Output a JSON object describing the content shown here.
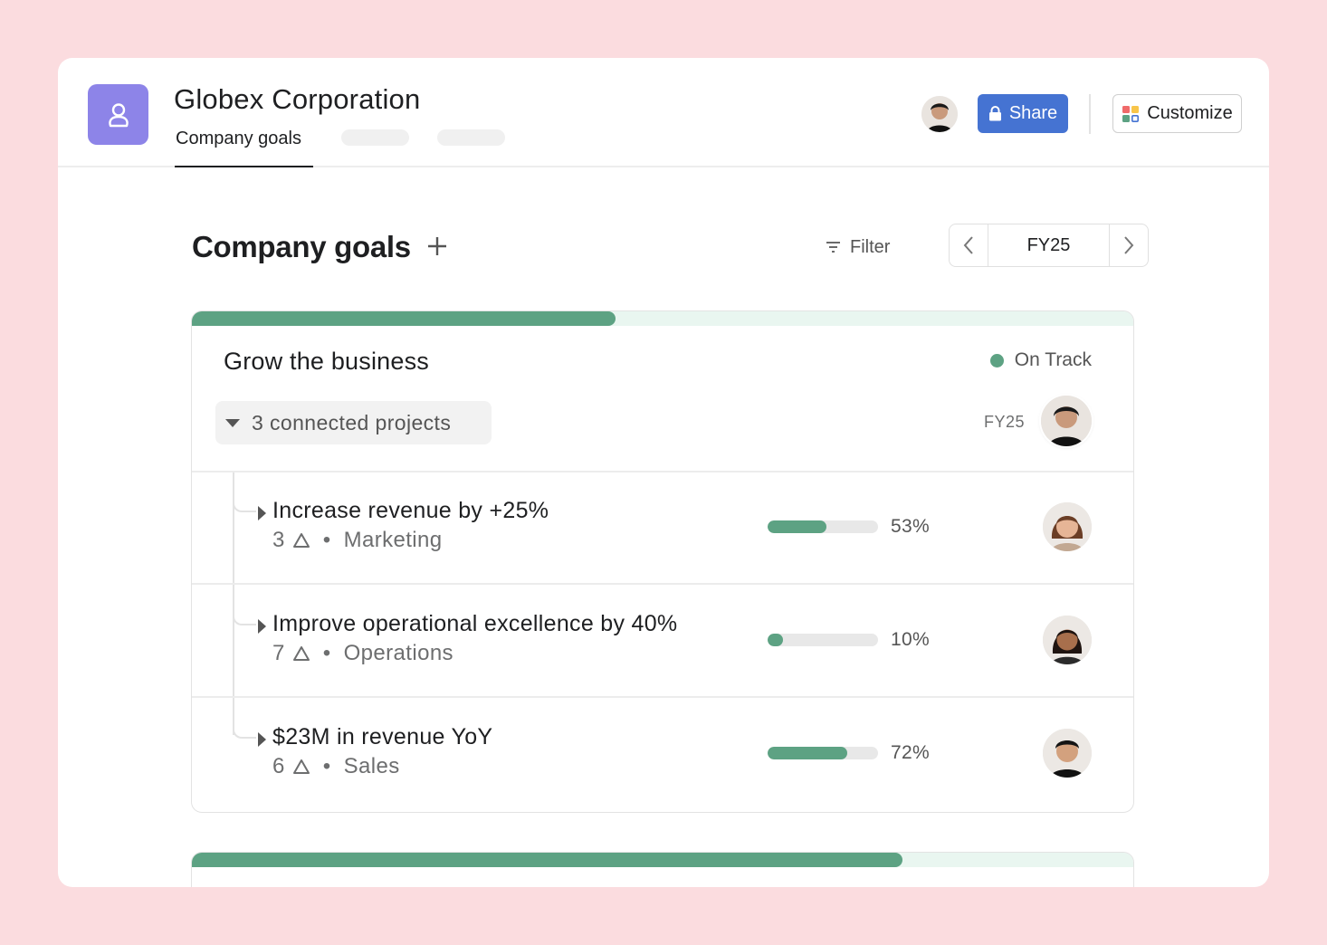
{
  "header": {
    "org_title": "Globex Corporation",
    "tabs": [
      {
        "label": "Company goals",
        "active": true
      },
      {
        "label": "",
        "active": false
      },
      {
        "label": "",
        "active": false
      }
    ],
    "share_label": "Share",
    "customize_label": "Customize"
  },
  "page": {
    "title": "Company goals",
    "filter_label": "Filter",
    "period": "FY25"
  },
  "goal": {
    "title": "Grow the business",
    "status": "On Track",
    "progress_fraction": 0.45,
    "projects_label": "3 connected projects",
    "period": "FY25",
    "sub_goals": [
      {
        "title": "Increase revenue by +25%",
        "count": "3",
        "team": "Marketing",
        "progress": 53,
        "progress_label": "53%"
      },
      {
        "title": "Improve operational excellence by 40%",
        "count": "7",
        "team": "Operations",
        "progress": 10,
        "progress_label": "10%"
      },
      {
        "title": "$23M in revenue YoY",
        "count": "6",
        "team": "Sales",
        "progress": 72,
        "progress_label": "72%"
      }
    ]
  },
  "next_goal": {
    "progress_fraction": 0.755
  },
  "colors": {
    "background": "#fbdcdf",
    "accent_purple": "#8d84e8",
    "share_blue": "#4573d2",
    "progress_green": "#5da283",
    "progress_track": "#e9f6f0"
  },
  "icons": {
    "app": "person-icon",
    "share": "lock-icon",
    "customize": "grid-icon",
    "filter": "filter-icon",
    "prev": "chevron-left-icon",
    "next": "chevron-right-icon",
    "add": "plus-icon",
    "expand": "caret-down-icon",
    "sub_expand": "caret-right-icon",
    "subgoal_count": "goal-triangle-icon"
  }
}
